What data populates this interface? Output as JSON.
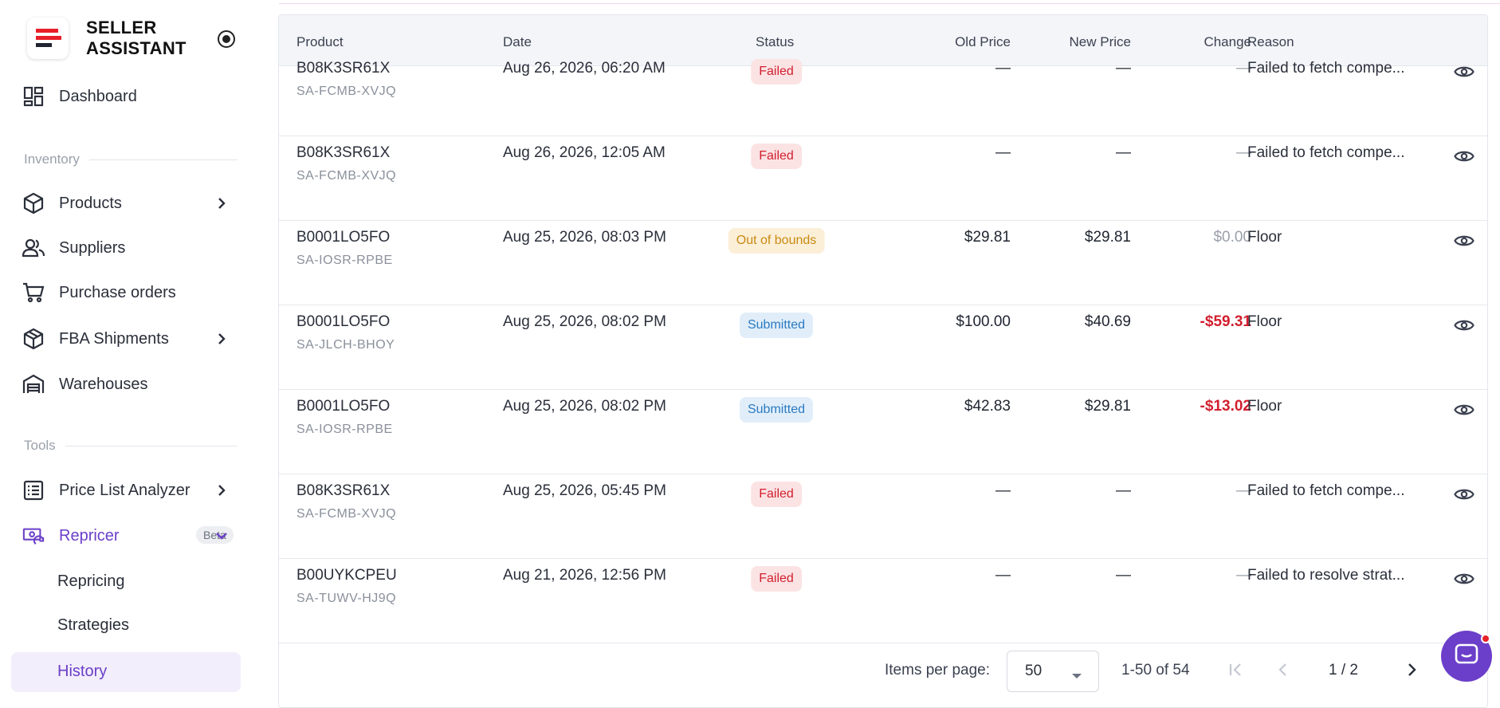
{
  "app": {
    "brand": "SELLER ASSISTANT"
  },
  "sidebar": {
    "dashboard": "Dashboard",
    "section_inventory": "Inventory",
    "products": "Products",
    "suppliers": "Suppliers",
    "purchase_orders": "Purchase orders",
    "fba_shipments": "FBA Shipments",
    "warehouses": "Warehouses",
    "section_tools": "Tools",
    "price_list_analyzer": "Price List Analyzer",
    "repricer": "Repricer",
    "repricer_badge": "Beta",
    "repricing": "Repricing",
    "strategies": "Strategies",
    "history": "History"
  },
  "colors": {
    "accent": "#6b3fc9",
    "failed_bg": "#fbe3e4",
    "failed_text": "#d21f2e",
    "oob_bg": "#fcefd8",
    "oob_text": "#c88a11",
    "submitted_bg": "#e1eef9",
    "submitted_text": "#2b7ac2",
    "negative": "#d21f2e"
  },
  "table": {
    "headers": {
      "product": "Product",
      "date": "Date",
      "status": "Status",
      "old_price": "Old Price",
      "new_price": "New Price",
      "change": "Change",
      "reason": "Reason"
    },
    "rows": [
      {
        "asin": "B08K3SR61X",
        "sku": "SA-FCMB-XVJQ",
        "date": "Aug 26, 2026, 06:20 AM",
        "status": "Failed",
        "old": "—",
        "new": "—",
        "change": "—",
        "reason": "Failed to fetch compe..."
      },
      {
        "asin": "B08K3SR61X",
        "sku": "SA-FCMB-XVJQ",
        "date": "Aug 26, 2026, 12:05 AM",
        "status": "Failed",
        "old": "—",
        "new": "—",
        "change": "—",
        "reason": "Failed to fetch compe..."
      },
      {
        "asin": "B0001LO5FO",
        "sku": "SA-IOSR-RPBE",
        "date": "Aug 25, 2026, 08:03 PM",
        "status": "Out of bounds",
        "old": "$29.81",
        "new": "$29.81",
        "change": "$0.00",
        "reason": "Floor"
      },
      {
        "asin": "B0001LO5FO",
        "sku": "SA-JLCH-BHOY",
        "date": "Aug 25, 2026, 08:02 PM",
        "status": "Submitted",
        "old": "$100.00",
        "new": "$40.69",
        "change": "-$59.31",
        "reason": "Floor"
      },
      {
        "asin": "B0001LO5FO",
        "sku": "SA-IOSR-RPBE",
        "date": "Aug 25, 2026, 08:02 PM",
        "status": "Submitted",
        "old": "$42.83",
        "new": "$29.81",
        "change": "-$13.02",
        "reason": "Floor"
      },
      {
        "asin": "B08K3SR61X",
        "sku": "SA-FCMB-XVJQ",
        "date": "Aug 25, 2026, 05:45 PM",
        "status": "Failed",
        "old": "—",
        "new": "—",
        "change": "—",
        "reason": "Failed to fetch compe..."
      },
      {
        "asin": "B00UYKCPEU",
        "sku": "SA-TUWV-HJ9Q",
        "date": "Aug 21, 2026, 12:56 PM",
        "status": "Failed",
        "old": "—",
        "new": "—",
        "change": "—",
        "reason": "Failed to resolve strat..."
      }
    ]
  },
  "pagination": {
    "items_per_page_label": "Items per page:",
    "items_per_page": "50",
    "range": "1-50 of 54",
    "page": "1 / 2"
  }
}
